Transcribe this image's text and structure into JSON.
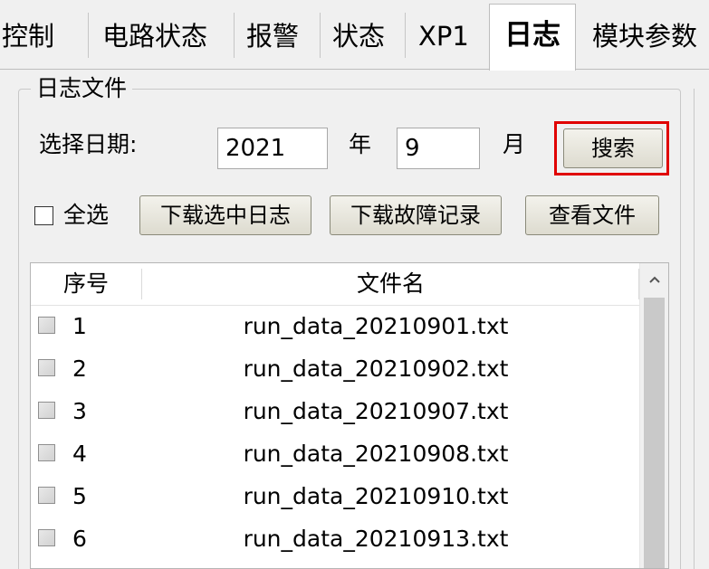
{
  "tabs": [
    {
      "label": "控制",
      "active": false
    },
    {
      "label": "电路状态",
      "active": false
    },
    {
      "label": "报警",
      "active": false
    },
    {
      "label": "状态",
      "active": false
    },
    {
      "label": "XP1",
      "active": false
    },
    {
      "label": "日志",
      "active": true
    },
    {
      "label": "模块参数",
      "active": false
    }
  ],
  "log_group": {
    "title": "日志文件",
    "date_label": "选择日期:",
    "year_value": "2021",
    "year_unit": "年",
    "month_value": "9",
    "month_unit": "月",
    "search_label": "搜索",
    "select_all_label": "全选",
    "select_all_checked": false,
    "download_selected_label": "下载选中日志",
    "download_fault_label": "下载故障记录",
    "view_file_label": "查看文件"
  },
  "table": {
    "columns": [
      "序号",
      "文件名"
    ],
    "rows": [
      {
        "index": "1",
        "filename": "run_data_20210901.txt",
        "checked": false
      },
      {
        "index": "2",
        "filename": "run_data_20210902.txt",
        "checked": false
      },
      {
        "index": "3",
        "filename": "run_data_20210907.txt",
        "checked": false
      },
      {
        "index": "4",
        "filename": "run_data_20210908.txt",
        "checked": false
      },
      {
        "index": "5",
        "filename": "run_data_20210910.txt",
        "checked": false
      },
      {
        "index": "6",
        "filename": "run_data_20210913.txt",
        "checked": false
      }
    ]
  },
  "icons": {
    "scroll_up": "chevron-up-icon"
  },
  "colors": {
    "highlight_border": "#e00000",
    "button_face": "#e8e6dc",
    "window_bg": "#f0f0f0"
  }
}
